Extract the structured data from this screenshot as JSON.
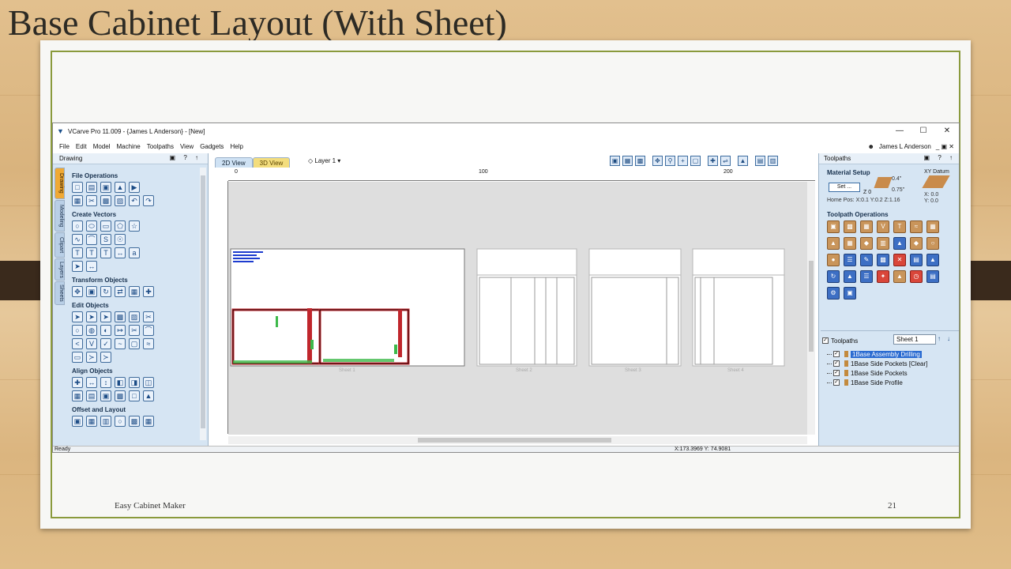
{
  "slide": {
    "title": "Base Cabinet Layout (With Sheet)",
    "footer_left": "Easy Cabinet Maker",
    "page_number": "21"
  },
  "app": {
    "window_title": "VCarve Pro 11.009 - {James L Anderson} - [New]",
    "window_buttons": [
      "—",
      "☐",
      "✕"
    ],
    "menu": [
      "File",
      "Edit",
      "Model",
      "Machine",
      "Toolpaths",
      "View",
      "Gadgets",
      "Help"
    ],
    "user": "James L Anderson",
    "user_controls": "_ ▣ ✕"
  },
  "left_panel": {
    "title": "Drawing",
    "header_controls": "▣ ? ↑",
    "tabs": [
      "Drawing",
      "Modeling",
      "Clipart",
      "Layers",
      "Sheets"
    ],
    "groups": [
      {
        "title": "File Operations"
      },
      {
        "title": "Create Vectors"
      },
      {
        "title": "Transform Objects"
      },
      {
        "title": "Edit Objects"
      },
      {
        "title": "Align Objects"
      },
      {
        "title": "Offset and Layout"
      }
    ]
  },
  "view": {
    "tab_2d": "2D View",
    "tab_3d": "3D View",
    "layer": "Layer 1 ▾",
    "ruler_h": [
      "0",
      "100",
      "200"
    ],
    "sheets": [
      "Sheet 1",
      "Sheet 2",
      "Sheet 3",
      "Sheet 4"
    ]
  },
  "right_panel": {
    "title": "Toolpaths",
    "header_controls": "▣ ? ↑",
    "material_setup": "Material Setup",
    "set_button": "Set ...",
    "z0": "Z 0",
    "thickness_top": "0.4\"",
    "thickness": "0.75\"",
    "home_pos": "Home Pos:  X:0.1 Y:0.2 Z:1.16",
    "xy_datum": "XY Datum",
    "xy_x": "X: 0.0",
    "xy_y": "Y: 0.0",
    "toolpath_operations": "Toolpath Operations",
    "toolpaths_label": "Toolpaths",
    "sheet_select": "Sheet 1",
    "toolpaths": [
      {
        "name": "1Base Assembly Drilling",
        "selected": true
      },
      {
        "name": "1Base Side Pockets [Clear]",
        "selected": false
      },
      {
        "name": "1Base Side Pockets",
        "selected": false
      },
      {
        "name": "1Base Side Profile",
        "selected": false
      }
    ]
  },
  "status": {
    "ready": "Ready",
    "coords": "X:173.3969 Y: 74.9081"
  }
}
